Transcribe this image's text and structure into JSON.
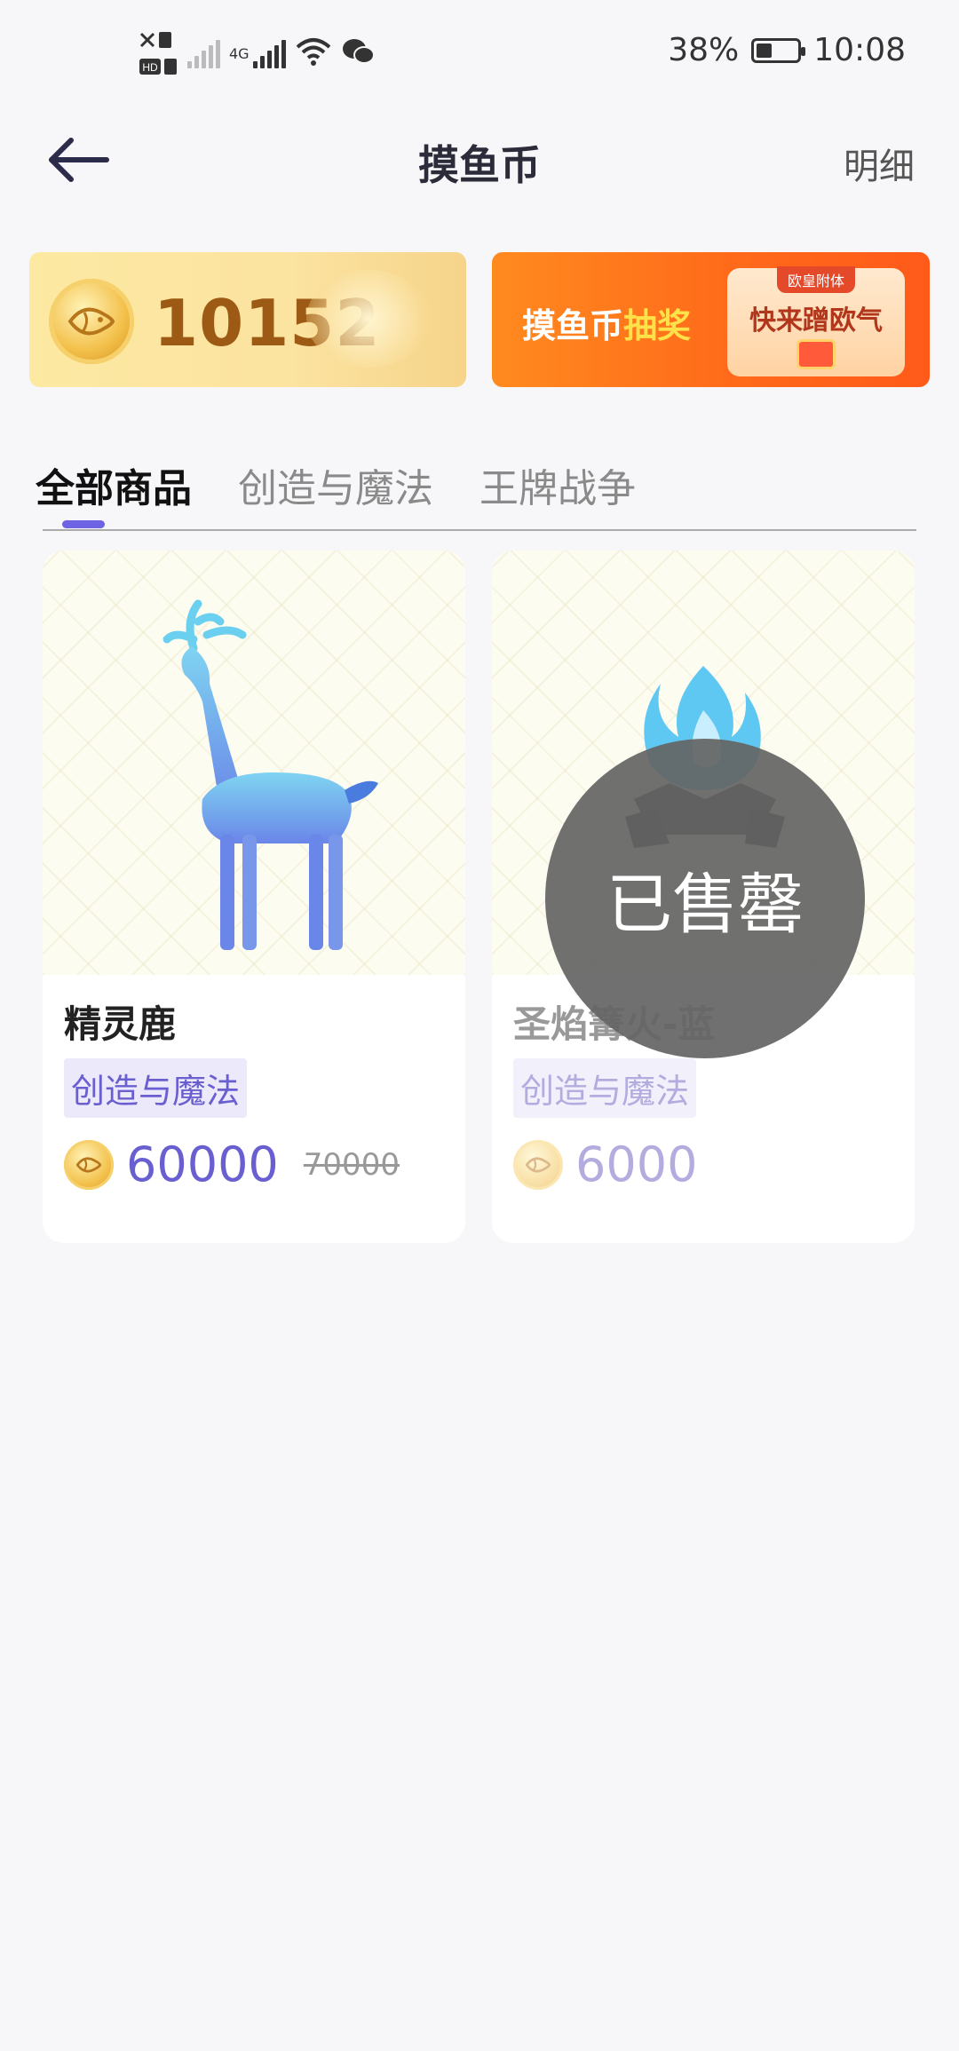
{
  "status_bar": {
    "network": "4G",
    "battery": "38%",
    "battery_level": 0.38,
    "time": "10:08"
  },
  "nav": {
    "title": "摸鱼币",
    "detail": "明细",
    "back_icon": "arrow-left-icon"
  },
  "banners": {
    "balance": "10152",
    "lottery_text_a": "摸鱼币",
    "lottery_text_b": "抽奖",
    "lottery_card_tag": "欧皇附体",
    "lottery_card_text": "快来蹭欧气"
  },
  "tabs": [
    "全部商品",
    "创造与魔法",
    "王牌战争"
  ],
  "products": [
    {
      "name": "精灵鹿",
      "tag": "创造与魔法",
      "price": "60000",
      "original_price": "70000",
      "sold_out": false
    },
    {
      "name": "圣焰篝火-蓝",
      "tag": "创造与魔法",
      "price": "6000",
      "original_price": "",
      "sold_out": true,
      "sold_out_label": "已售罄"
    }
  ],
  "colors": {
    "accent": "#6a5fd0",
    "indicator": "#6d63e3",
    "balance_text": "#9c5a14",
    "lottery_bg": "#ff6a1a"
  }
}
